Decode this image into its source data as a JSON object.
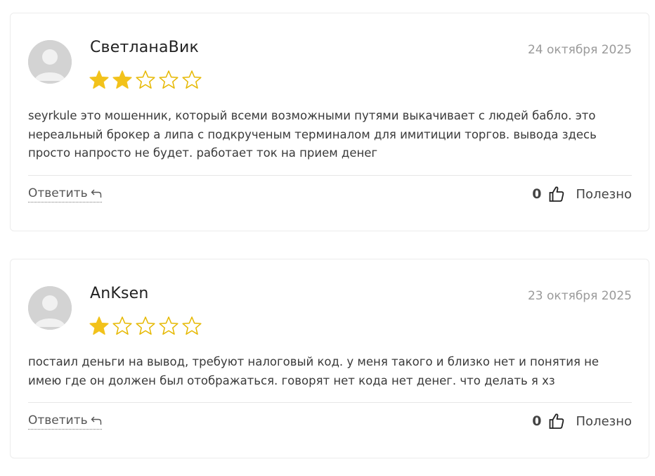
{
  "reviews": [
    {
      "author": "СветланаВик",
      "date": "24 октября 2025",
      "rating": 2,
      "max_rating": 5,
      "text": "seyrkule это мошенник, который всеми возможными путями выкачивает с людей бабло. это нереальный брокер а липа с подкрученым терминалом для имитиции торгов. вывода здесь просто напросто не будет. работает ток на прием денег",
      "reply_label": "Ответить",
      "helpful_count": "0",
      "helpful_label": "Полезно"
    },
    {
      "author": "AnKsen",
      "date": "23 октября 2025",
      "rating": 1,
      "max_rating": 5,
      "text": "постаил деньги на вывод, требуют налоговый код. у меня такого и близко нет и понятия не имею где он должен был отображаться. говорят нет кода нет денег. что делать я хз",
      "reply_label": "Ответить",
      "helpful_count": "0",
      "helpful_label": "Полезно"
    }
  ],
  "colors": {
    "star_filled": "#f2c21b",
    "star_empty_stroke": "#e6b800",
    "avatar_bg": "#d3d3d3",
    "avatar_fg": "#f1f1f1"
  },
  "icons": {
    "avatar": "user-placeholder-icon",
    "star": "star-icon",
    "reply": "reply-arrow-icon",
    "helpful": "thumbs-up-icon"
  }
}
